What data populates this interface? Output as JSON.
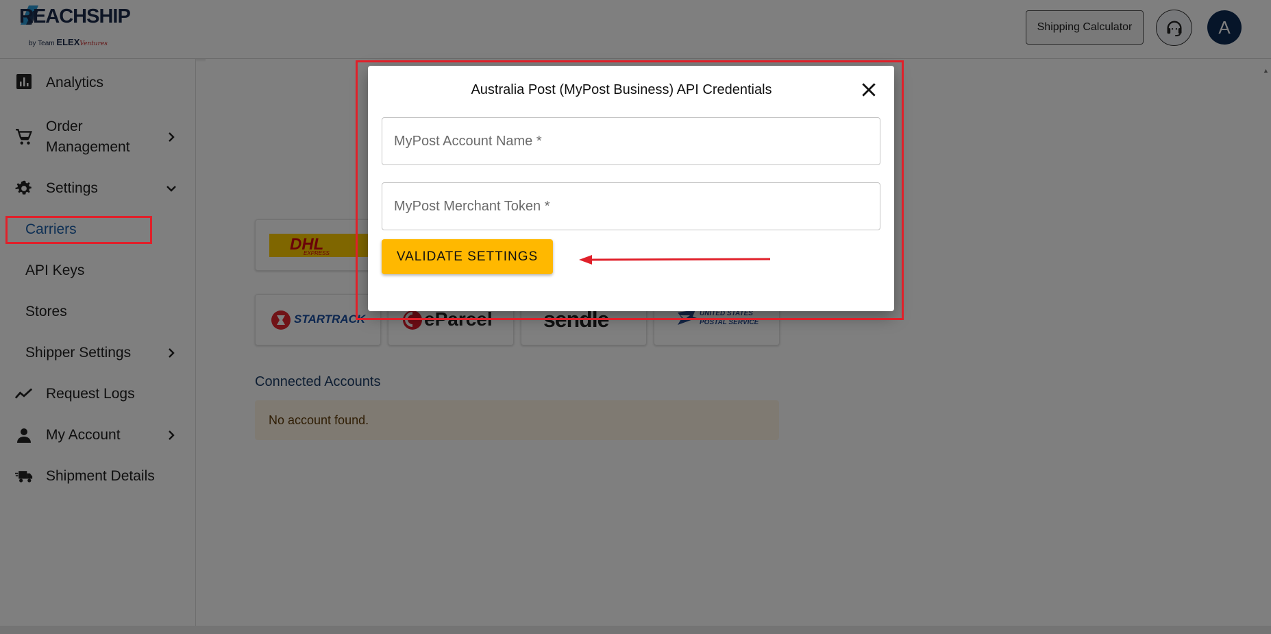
{
  "header": {
    "logo_main": "REACHSHIP",
    "logo_by": "by Team",
    "logo_brand": "ELEX",
    "logo_brand_tail": "Ventures",
    "shipping_calculator_label": "Shipping Calculator",
    "avatar_initial": "A"
  },
  "sidebar": {
    "items": [
      {
        "label": "Analytics",
        "icon": "bar-chart-icon"
      },
      {
        "label": "Order Management",
        "icon": "cart-icon",
        "has_chevron": true
      },
      {
        "label": "Settings",
        "icon": "gear-icon",
        "expanded": true
      },
      {
        "label": "Request Logs",
        "icon": "trend-icon"
      },
      {
        "label": "My Account",
        "icon": "person-icon",
        "has_chevron": true
      },
      {
        "label": "Shipment Details",
        "icon": "truck-icon"
      }
    ],
    "order_management_line1": "Order",
    "order_management_line2": "Management",
    "settings_children": [
      {
        "label": "Carriers",
        "active": true
      },
      {
        "label": "API Keys"
      },
      {
        "label": "Stores"
      },
      {
        "label": "Shipper Settings",
        "has_chevron": true
      }
    ]
  },
  "carriers": {
    "cards": [
      {
        "name": "DHL",
        "subtitle": "EXPRESS"
      },
      {
        "name": "STARTRACK"
      },
      {
        "name": "eParcel"
      },
      {
        "name": "sendle"
      },
      {
        "name": "UNITED STATES",
        "subtitle": "POSTAL SERVICE"
      }
    ]
  },
  "connected_accounts": {
    "title": "Connected Accounts",
    "empty_message": "No account found."
  },
  "modal": {
    "title": "Australia Post (MyPost Business) API Credentials",
    "account_name_placeholder": "MyPost Account Name *",
    "account_name_value": "",
    "merchant_token_placeholder": "MyPost Merchant Token *",
    "merchant_token_value": "",
    "validate_label": "VALIDATE SETTINGS"
  },
  "colors": {
    "accent": "#ffb800",
    "annotation": "#e0202a",
    "active_link": "#1a5fa8",
    "avatar_bg": "#0d2a52",
    "alert_bg": "#fff4e5"
  }
}
